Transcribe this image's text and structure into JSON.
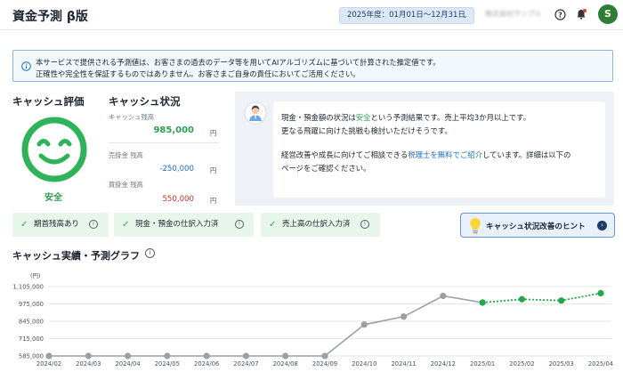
{
  "header": {
    "title": "資金予測 β版",
    "fiscal_year": "2025年度：01月01日〜12月31日",
    "company_name": "株式会社サンプル",
    "avatar_initial": "S"
  },
  "notice": {
    "line1": "本サービスで提供される予測値は、お客さまの過去のデータ等を用いてAIアルゴリズムに基づいて計算された推定値です。",
    "line2": "正確性や完全性を保証するものではありません。お客さまご自身の責任においてご活用ください。"
  },
  "evaluation": {
    "title": "キャッシュ評価",
    "label": "安全",
    "color": "#2e9e4f"
  },
  "status": {
    "title": "キャッシュ状況",
    "cash_label": "キャッシュ残高",
    "cash_value": "985,000",
    "receivable_label": "売掛金 残高",
    "receivable_value": "-250,000",
    "payable_label": "買掛金 残高",
    "payable_value": "550,000",
    "unit": "円"
  },
  "message": {
    "l1a": "現金・預金額の状況は",
    "l1b": "安全",
    "l1c": "という予測結果です。売上平均3か月以上です。",
    "l2": "更なる飛躍に向けた挑戦も検討いただけそうです。",
    "l3a": "経営改善や成長に向けてご相談できる",
    "l3b": "税理士を無料でご紹介",
    "l3c": "しています。詳細は以下の",
    "l4": "ページをご確認ください。"
  },
  "chips": [
    {
      "label": "期首残高あり"
    },
    {
      "label": "現金・預金の仕訳入力済"
    },
    {
      "label": "売上高の仕訳入力済"
    }
  ],
  "hint_button": {
    "label": "キャッシュ状況改善のヒント"
  },
  "chart_title": "キャッシュ実績・予測グラフ",
  "chart_data": {
    "type": "line",
    "unit_label": "(円)",
    "x": [
      "2024/02",
      "2024/03",
      "2024/04",
      "2024/05",
      "2024/06",
      "2024/07",
      "2024/08",
      "2024/09",
      "2024/10",
      "2024/11",
      "2024/12",
      "2025/01",
      "2025/02",
      "2025/03",
      "2025/04"
    ],
    "y_ticks": [
      585000,
      715000,
      845000,
      975000,
      1105000
    ],
    "y_tick_labels": [
      "585,000",
      "715,000",
      "845,000",
      "975,000",
      "1,105,000"
    ],
    "ylim": [
      585000,
      1105000
    ],
    "series": [
      {
        "values": [
          585000,
          585000,
          585000,
          585000,
          585000,
          585000,
          585000,
          585000,
          820000,
          880000,
          1035000,
          985000,
          null,
          null,
          null
        ],
        "color": "#9aa0a6"
      },
      {
        "values": [
          null,
          null,
          null,
          null,
          null,
          null,
          null,
          null,
          null,
          null,
          null,
          985000,
          1010000,
          1000000,
          1055000
        ],
        "color": "#22a74a"
      }
    ],
    "grid": true
  }
}
